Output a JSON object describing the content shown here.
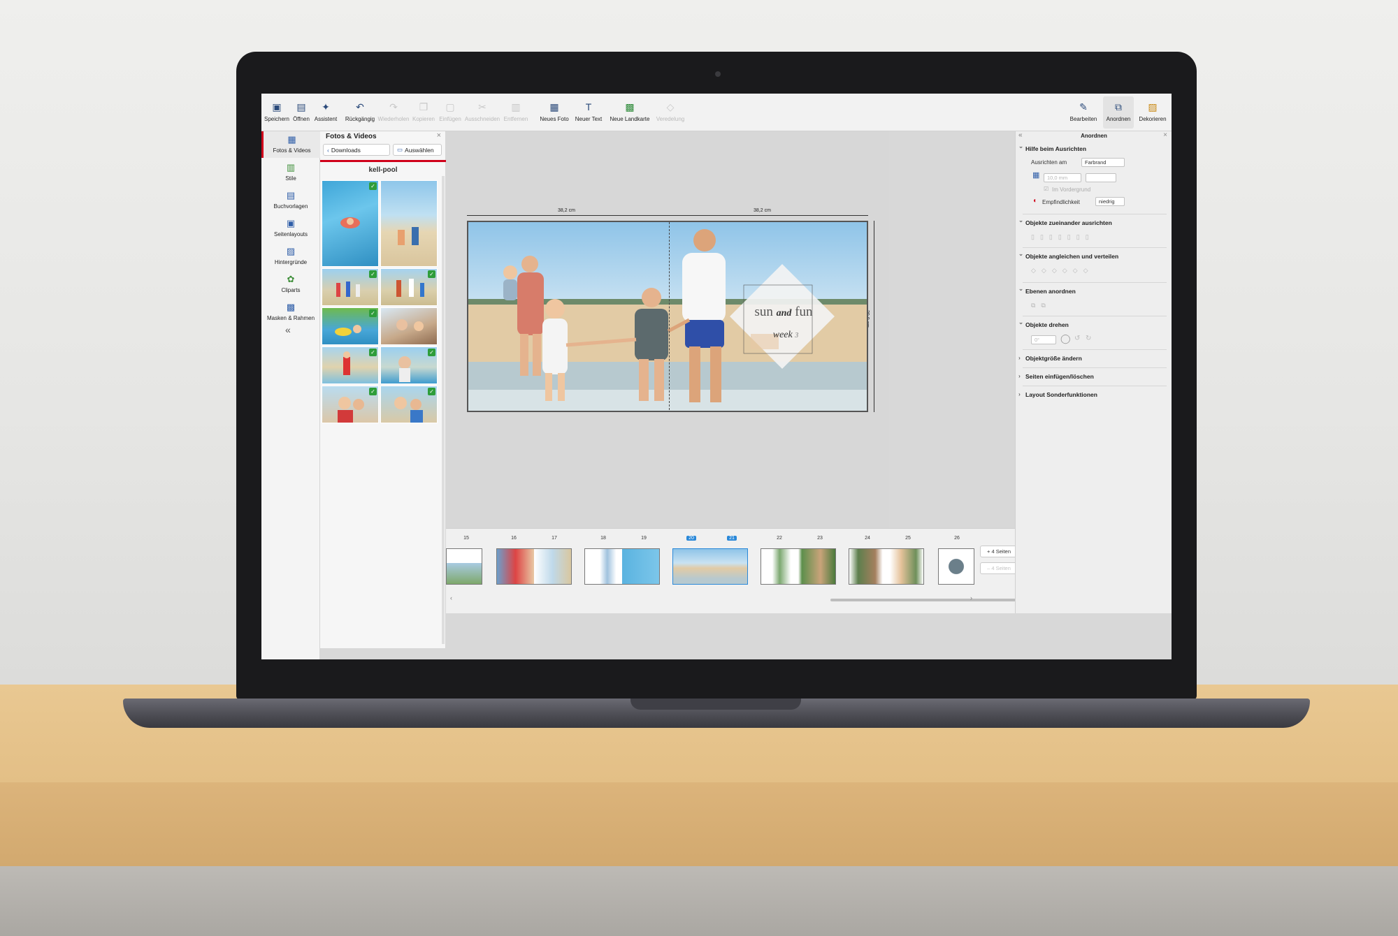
{
  "toolbar": {
    "buttons": [
      {
        "label": "Speichern",
        "icon": "save-icon",
        "enabled": true
      },
      {
        "label": "Öffnen",
        "icon": "open-icon",
        "enabled": true
      },
      {
        "label": "Assistent",
        "icon": "wand-icon",
        "enabled": true
      },
      {
        "label": "Rückgängig",
        "icon": "undo-icon",
        "enabled": true
      },
      {
        "label": "Wiederholen",
        "icon": "redo-icon",
        "enabled": false
      },
      {
        "label": "Kopieren",
        "icon": "copy-icon",
        "enabled": false
      },
      {
        "label": "Einfügen",
        "icon": "paste-icon",
        "enabled": false
      },
      {
        "label": "Ausschneiden",
        "icon": "cut-icon",
        "enabled": false
      },
      {
        "label": "Entfernen",
        "icon": "trash-icon",
        "enabled": false
      },
      {
        "label": "Neues Foto",
        "icon": "new-photo-icon",
        "enabled": true
      },
      {
        "label": "Neuer Text",
        "icon": "new-text-icon",
        "enabled": true
      },
      {
        "label": "Neue Landkarte",
        "icon": "map-icon",
        "enabled": true
      },
      {
        "label": "Veredelung",
        "icon": "finishing-icon",
        "enabled": false
      }
    ],
    "right_buttons": [
      {
        "label": "Bearbeiten",
        "icon": "edit-icon",
        "active": false
      },
      {
        "label": "Anordnen",
        "icon": "arrange-icon",
        "active": true
      },
      {
        "label": "Dekorieren",
        "icon": "decorate-icon",
        "active": false
      }
    ]
  },
  "leftnav": {
    "items": [
      {
        "label": "Fotos & Videos",
        "icon": "photos-icon",
        "active": true
      },
      {
        "label": "Stile",
        "icon": "styles-icon",
        "active": false
      },
      {
        "label": "Buchvorlagen",
        "icon": "book-templates-icon",
        "active": false
      },
      {
        "label": "Seitenlayouts",
        "icon": "page-layouts-icon",
        "active": false
      },
      {
        "label": "Hintergründe",
        "icon": "backgrounds-icon",
        "active": false
      },
      {
        "label": "Cliparts",
        "icon": "cliparts-icon",
        "active": false
      },
      {
        "label": "Masken & Rahmen",
        "icon": "masks-frames-icon",
        "active": false
      }
    ],
    "collapse_glyph": "«"
  },
  "photo_panel": {
    "title": "Fotos & Videos",
    "back_button": "Downloads",
    "select_button": "Auswählen",
    "folder": "kell-pool",
    "thumbs": [
      {
        "checked": true
      },
      {
        "checked": false
      },
      {
        "checked": true
      },
      {
        "checked": true
      },
      {
        "checked": true
      },
      {
        "checked": false
      },
      {
        "checked": true
      },
      {
        "checked": true
      },
      {
        "checked": true
      },
      {
        "checked": true
      }
    ]
  },
  "canvas": {
    "width_left": "38,2 cm",
    "width_right": "38,2 cm",
    "height": "29,0 cm",
    "title_text_1": "sun",
    "title_text_and": "and",
    "title_text_2": "fun",
    "subtitle_text": "week",
    "subtitle_num": "3"
  },
  "page_strip": {
    "pages": [
      "15",
      "16",
      "17",
      "18",
      "19",
      "20",
      "21",
      "22",
      "23",
      "24",
      "25",
      "26"
    ],
    "selected": [
      "20",
      "21"
    ],
    "add_button": "+ 4 Seiten",
    "remove_button": "– 4 Seiten"
  },
  "right_panel": {
    "title": "Anordnen",
    "sections": {
      "align_help": "Hilfe beim Ausrichten",
      "align_to_label": "Ausrichten am",
      "align_to_value": "Farbrand",
      "grid_value": "10,0 mm",
      "foreground_label": "Im Vordergrund",
      "sensitivity_label": "Empfindlichkeit",
      "sensitivity_value": "niedrig",
      "align_objects": "Objekte zueinander ausrichten",
      "match_objects": "Objekte angleichen und verteilen",
      "layers": "Ebenen anordnen",
      "rotate": "Objekte drehen",
      "rotate_value": "0°",
      "resize": "Objektgröße ändern",
      "pages": "Seiten einfügen/löschen",
      "special": "Layout Sonderfunktionen"
    }
  },
  "colors": {
    "accent_red": "#d0021b",
    "selection_blue": "#2a88d8",
    "check_green": "#2e9d3a"
  }
}
